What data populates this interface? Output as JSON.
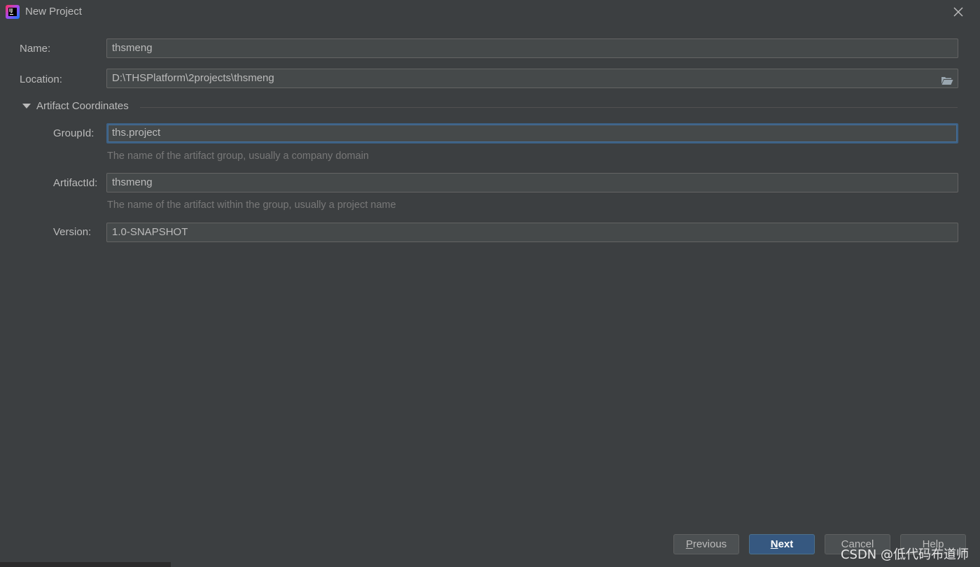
{
  "window": {
    "title": "New Project",
    "app_icon": "intellij-idea-icon",
    "close_icon": "close-icon"
  },
  "form": {
    "name": {
      "label": "Name:",
      "value": "thsmeng"
    },
    "location": {
      "label": "Location:",
      "value": "D:\\THSPlatform\\2projects\\thsmeng",
      "icon": "folder-icon"
    },
    "artifact_section": {
      "title": "Artifact Coordinates",
      "expanded": true,
      "group_id": {
        "label": "GroupId:",
        "value": "ths.project",
        "hint": "The name of the artifact group, usually a company domain"
      },
      "artifact_id": {
        "label": "ArtifactId:",
        "value": "thsmeng",
        "hint": "The name of the artifact within the group, usually a project name"
      },
      "version": {
        "label": "Version:",
        "value": "1.0-SNAPSHOT"
      }
    }
  },
  "buttons": {
    "previous": {
      "mnemonic": "P",
      "rest": "revious"
    },
    "next": {
      "mnemonic": "N",
      "rest": "ext"
    },
    "cancel": {
      "label": "Cancel"
    },
    "help": {
      "label": "Help"
    }
  },
  "watermark": "CSDN @低代码布道师",
  "colors": {
    "background": "#3c3f41",
    "field_bg": "#45494a",
    "focus_border": "#3d6185",
    "primary_button": "#365880",
    "hint_text": "#787878"
  }
}
